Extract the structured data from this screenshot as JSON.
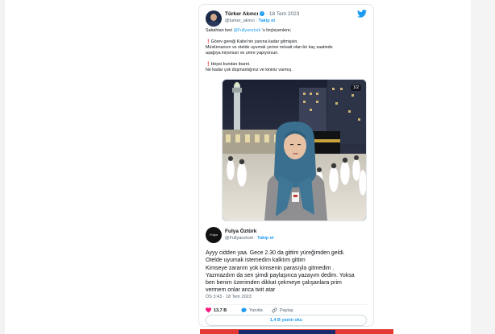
{
  "tweet": {
    "author_name": "Türker Akıncı",
    "date": "18 Tem 2023",
    "handle": "@turker_akinci",
    "follow_label": "Takip et",
    "intro_before": "Sabahtan beri ",
    "intro_mention": "@Fullyaozturk",
    "intro_after": " 'u linçleyenlere;",
    "para1_line1": "Görev gereği Kabe'nin yanına kadar gitmişsin.",
    "para1_line2": "Müslümansın ve otelde uyumak yerine müsait olan bir kaç saatinde",
    "para1_line3": "aşağıya iniyorsun ve umre yapıyorsun.",
    "para2_line1": "Hepsi bundan ibaret.",
    "para2_line2": "Ne kadar çok düşmanlığınız ve kininiz varmış.",
    "photo_counter": "1/2"
  },
  "quote": {
    "author_name": "Fulya Öztürk",
    "avatar_text": "Fulya",
    "handle": "@Fullyaozturk",
    "follow_label": "Takip et",
    "line1": "Ayyy cidden yaa. Gece 2.30 da gittim yüreğimden geldi.",
    "line2": "Otelde uyumak istemedim kalktım gittim",
    "line3": "Kimseye zararım yok kimsenin parasıyla gitmedim .",
    "line4": "Yazmazdım da sen şimdi paylaşınca yazayım dedim. Yoksa",
    "line5": "ben benim üzerimden dikkat çekmeye çalışanlara prim",
    "line6": "vermem onlar anca twit atar",
    "timestamp": "ÖS 3:43 · 18 Tem 2023"
  },
  "actions": {
    "like_count": "13,7 B",
    "reply_label": "Yanıtla",
    "share_label": "Paylaş"
  },
  "replies_button": "1,4 B yanıtı oku",
  "colors": {
    "accent": "#1d9bf0",
    "like": "#f91880",
    "alert": "#e0245e"
  }
}
